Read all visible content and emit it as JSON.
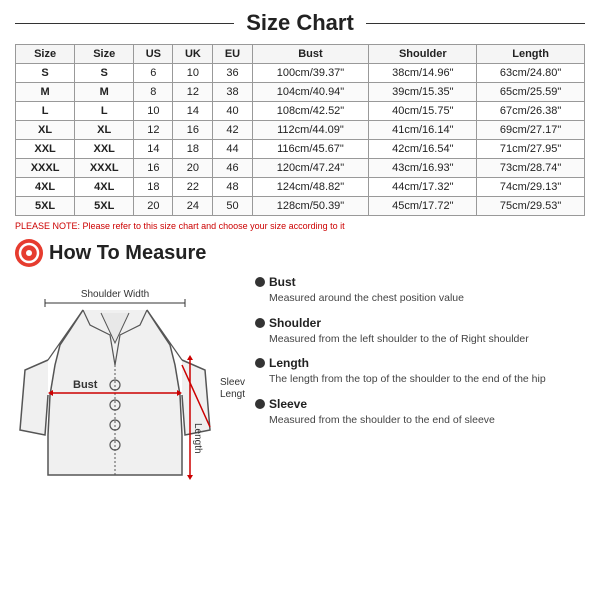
{
  "title": "Size Chart",
  "table": {
    "headers": [
      "Size",
      "Size",
      "US",
      "UK",
      "EU",
      "Bust",
      "Shoulder",
      "Length"
    ],
    "rows": [
      [
        "S",
        "S",
        "6",
        "10",
        "36",
        "100cm/39.37\"",
        "38cm/14.96\"",
        "63cm/24.80\""
      ],
      [
        "M",
        "M",
        "8",
        "12",
        "38",
        "104cm/40.94\"",
        "39cm/15.35\"",
        "65cm/25.59\""
      ],
      [
        "L",
        "L",
        "10",
        "14",
        "40",
        "108cm/42.52\"",
        "40cm/15.75\"",
        "67cm/26.38\""
      ],
      [
        "XL",
        "XL",
        "12",
        "16",
        "42",
        "112cm/44.09\"",
        "41cm/16.14\"",
        "69cm/27.17\""
      ],
      [
        "XXL",
        "XXL",
        "14",
        "18",
        "44",
        "116cm/45.67\"",
        "42cm/16.54\"",
        "71cm/27.95\""
      ],
      [
        "XXXL",
        "XXXL",
        "16",
        "20",
        "46",
        "120cm/47.24\"",
        "43cm/16.93\"",
        "73cm/28.74\""
      ],
      [
        "4XL",
        "4XL",
        "18",
        "22",
        "48",
        "124cm/48.82\"",
        "44cm/17.32\"",
        "74cm/29.13\""
      ],
      [
        "5XL",
        "5XL",
        "20",
        "24",
        "50",
        "128cm/50.39\"",
        "45cm/17.72\"",
        "75cm/29.53\""
      ]
    ]
  },
  "note": "PLEASE NOTE: Please refer to this size chart and choose your size according to it",
  "how_to_measure_title": "How To Measure",
  "how_to_measure_icon": "O",
  "labels": {
    "shoulder_width": "Shoulder Width",
    "bust": "Bust",
    "sleeve_length": "Sleeve\nLength",
    "length": "Length"
  },
  "measurements": [
    {
      "title": "Bust",
      "desc": "Measured around the chest position value"
    },
    {
      "title": "Shoulder",
      "desc": "Measured from the left shoulder to the of Right shoulder"
    },
    {
      "title": "Length",
      "desc": "The length from the top of the shoulder to the end of the hip"
    },
    {
      "title": "Sleeve",
      "desc": "Measured from the shoulder to the end of sleeve"
    }
  ]
}
